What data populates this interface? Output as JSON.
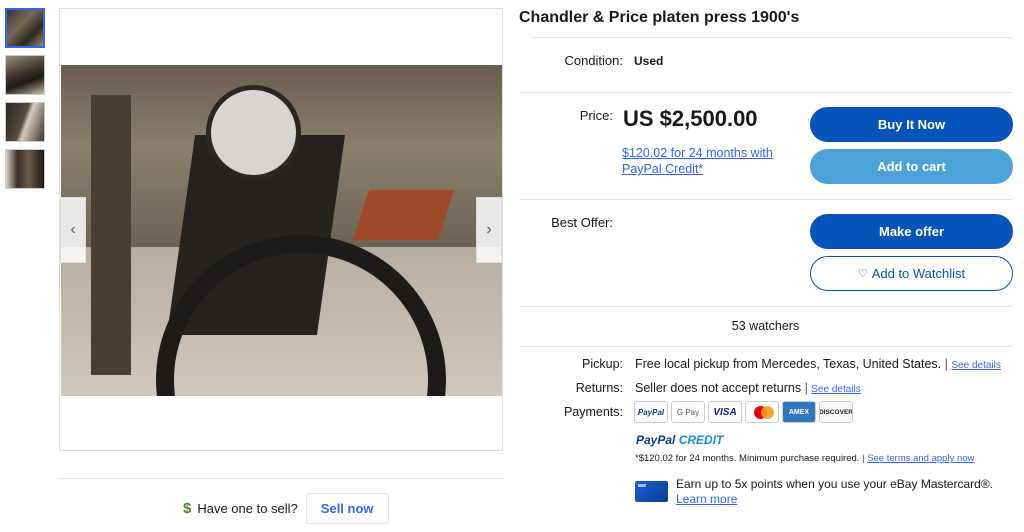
{
  "listing": {
    "title": "Chandler & Price platen press 1900's",
    "condition_label": "Condition:",
    "condition_value": "Used",
    "price_label": "Price:",
    "price": "US $2,500.00",
    "paypal_financing": "$120.02 for 24 months with PayPal Credit*",
    "best_offer_label": "Best Offer:",
    "watchers": "53 watchers"
  },
  "buttons": {
    "buy_it_now": "Buy It Now",
    "add_to_cart": "Add to cart",
    "make_offer": "Make offer",
    "add_to_watchlist": "Add to Watchlist"
  },
  "gallery": {
    "thumbnails": [
      "thumb-1",
      "thumb-2",
      "thumb-3",
      "thumb-4"
    ],
    "prev_arrow": "‹",
    "next_arrow": "›"
  },
  "sell": {
    "icon": "$",
    "prompt": "Have one to sell?",
    "button": "Sell now"
  },
  "shipping": {
    "pickup_label": "Pickup:",
    "pickup_value": "Free local pickup from Mercedes, Texas, United States.",
    "returns_label": "Returns:",
    "returns_value": "Seller does not accept returns",
    "see_details": "See details",
    "separator": "|",
    "payments_label": "Payments:"
  },
  "payments": {
    "methods": [
      "PayPal",
      "G Pay",
      "VISA",
      "Mastercard",
      "AMEX",
      "DISCOVER"
    ],
    "paypal_credit_1": "PayPal",
    "paypal_credit_2": "CREDIT",
    "credit_note": "*$120.02 for 24 months. Minimum purchase required.",
    "credit_terms_link": "See terms and apply now"
  },
  "mastercard_promo": {
    "text": "Earn up to 5x points when you use your eBay Mastercard®.",
    "link": "Learn more"
  },
  "colors": {
    "primary_blue": "#0654ba",
    "secondary_blue": "#4aa2d9",
    "link_blue": "#3665f3"
  }
}
